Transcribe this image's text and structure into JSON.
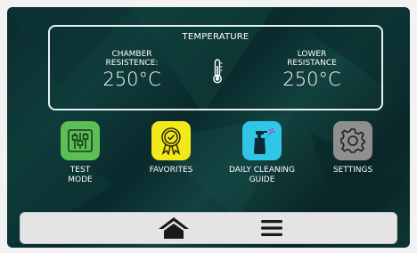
{
  "temperature": {
    "title": "TEMPERATURE",
    "left_label": "CHAMBER\nRESISTENCE:",
    "left_value": "250°C",
    "right_label": "LOWER\nRESISTANCE",
    "right_value": "250°C"
  },
  "apps": [
    {
      "label": "TEST\nMODE",
      "color": "#5bbf55",
      "icon": "sliders-icon"
    },
    {
      "label": "FAVORITES",
      "color": "#f3e81a",
      "icon": "award-ribbon-icon"
    },
    {
      "label": "DAILY CLEANING\nGUIDE",
      "color": "#2fc6e8",
      "icon": "spray-bottle-icon"
    },
    {
      "label": "SETTINGS",
      "color": "#8f8f8f",
      "icon": "gear-icon"
    }
  ],
  "nav": {
    "home_icon": "home-icon",
    "menu_icon": "hamburger-menu-icon"
  }
}
